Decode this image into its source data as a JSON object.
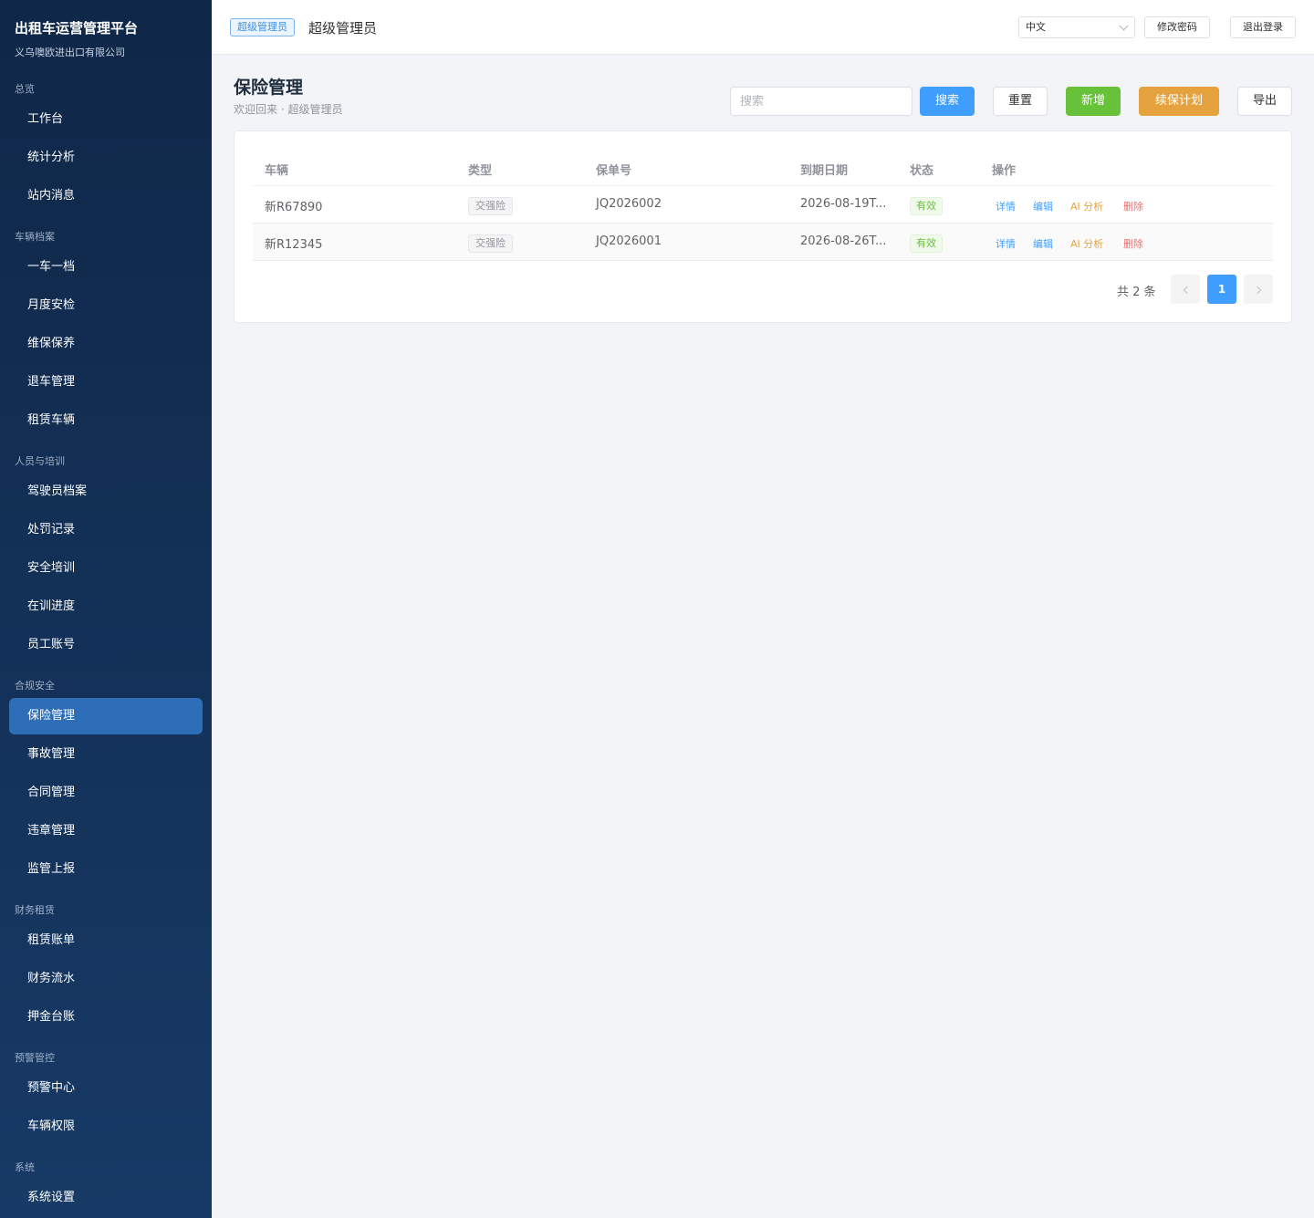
{
  "sidebar": {
    "title": "出租车运营管理平台",
    "subtitle": "义乌噢欧进出口有限公司",
    "groups": [
      {
        "label": "总览",
        "items": [
          "工作台",
          "统计分析",
          "站内消息"
        ]
      },
      {
        "label": "车辆档案",
        "items": [
          "一车一档",
          "月度安检",
          "维保保养",
          "退车管理",
          "租赁车辆"
        ]
      },
      {
        "label": "人员与培训",
        "items": [
          "驾驶员档案",
          "处罚记录",
          "安全培训",
          "在训进度",
          "员工账号"
        ]
      },
      {
        "label": "合规安全",
        "items": [
          "保险管理",
          "事故管理",
          "合同管理",
          "违章管理",
          "监管上报"
        ]
      },
      {
        "label": "财务租赁",
        "items": [
          "租赁账单",
          "财务流水",
          "押金台账"
        ]
      },
      {
        "label": "预警管控",
        "items": [
          "预警中心",
          "车辆权限"
        ]
      },
      {
        "label": "系统",
        "items": [
          "系统设置"
        ]
      }
    ],
    "active_item": "保险管理"
  },
  "topbar": {
    "role_tag": "超级管理员",
    "role_name": "超级管理员",
    "language": "中文",
    "change_password": "修改密码",
    "logout": "退出登录"
  },
  "page": {
    "title": "保险管理",
    "subtitle": "欢迎回来 · 超级管理员"
  },
  "toolbar": {
    "search_placeholder": "搜索",
    "search_value": "",
    "search_btn": "搜索",
    "reset_btn": "重置",
    "add_btn": "新增",
    "renew_btn": "续保计划",
    "export_btn": "导出"
  },
  "table": {
    "columns": [
      "车辆",
      "类型",
      "保单号",
      "到期日期",
      "状态",
      "操作"
    ],
    "rows": [
      {
        "vehicle": "新R67890",
        "type": "交强险",
        "policy_no": "JQ2026002",
        "expiry": "2026-08-19T...",
        "status": "有效"
      },
      {
        "vehicle": "新R12345",
        "type": "交强险",
        "policy_no": "JQ2026001",
        "expiry": "2026-08-26T...",
        "status": "有效"
      }
    ],
    "actions": {
      "detail": "详情",
      "edit": "编辑",
      "ai": "AI 分析",
      "delete": "删除"
    }
  },
  "pagination": {
    "total_text": "共 2 条",
    "current_page": "1"
  },
  "colors": {
    "sidebar_top": "#0f2748",
    "sidebar_bottom": "#173a66",
    "active_item": "#2e6db7",
    "primary": "#409eff",
    "success": "#67c23a",
    "warning": "#e6a23c",
    "danger": "#f56c6c"
  }
}
